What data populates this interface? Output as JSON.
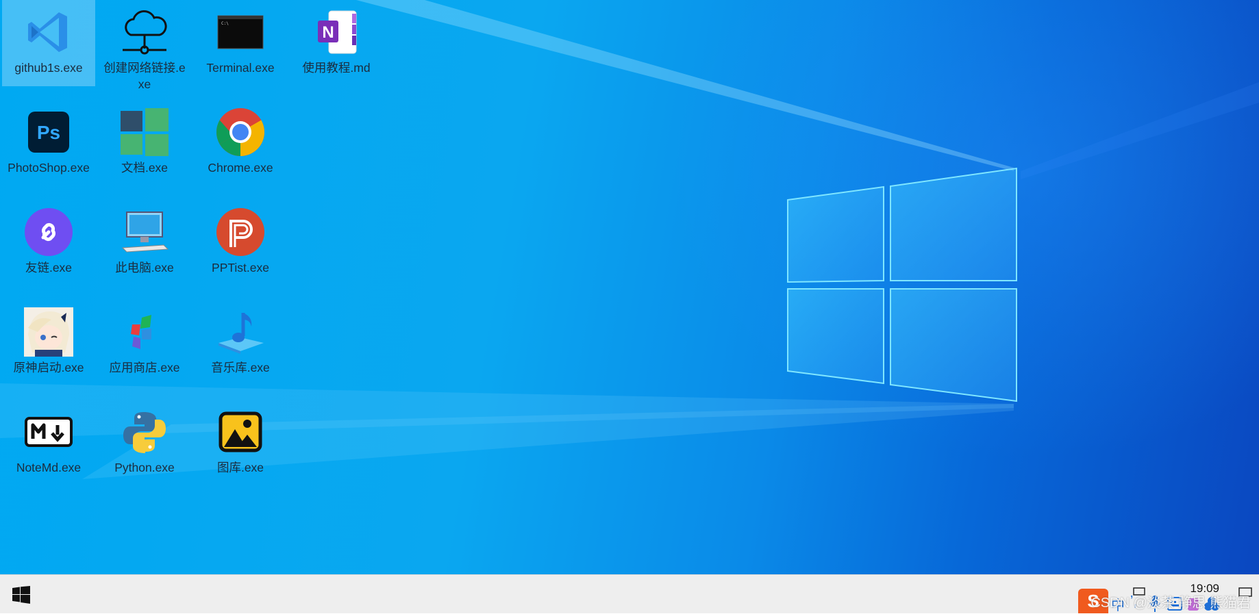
{
  "desktop": {
    "icons": [
      {
        "label": "github1s.exe",
        "icon": "vscode-icon"
      },
      {
        "label": "创建网络链接.exe",
        "icon": "network-cloud-icon"
      },
      {
        "label": "Terminal.exe",
        "icon": "terminal-icon"
      },
      {
        "label": "使用教程.md",
        "icon": "onenote-icon"
      },
      {
        "label": "PhotoShop.exe",
        "icon": "photoshop-icon"
      },
      {
        "label": "文档.exe",
        "icon": "windows-tiles-icon"
      },
      {
        "label": "Chrome.exe",
        "icon": "chrome-icon"
      },
      {
        "label": "友链.exe",
        "icon": "link-icon"
      },
      {
        "label": "此电脑.exe",
        "icon": "computer-icon"
      },
      {
        "label": "PPTist.exe",
        "icon": "pptist-icon"
      },
      {
        "label": "原神启动.exe",
        "icon": "anime-avatar-icon"
      },
      {
        "label": "应用商店.exe",
        "icon": "app-store-icon"
      },
      {
        "label": "音乐库.exe",
        "icon": "music-note-icon"
      },
      {
        "label": "NoteMd.exe",
        "icon": "markdown-icon"
      },
      {
        "label": "Python.exe",
        "icon": "python-icon"
      },
      {
        "label": "图库.exe",
        "icon": "gallery-icon"
      }
    ]
  },
  "taskbar": {
    "clock": "19:09",
    "tray_ime_label": "中",
    "watermark": "CSDN @淡茶 静思 熊猫君",
    "start_icon": "windows-start-icon"
  },
  "colors": {
    "wallpaper_light": "#00a9f2",
    "wallpaper_dark": "#0a47c0",
    "taskbar": "#eeeeee"
  }
}
